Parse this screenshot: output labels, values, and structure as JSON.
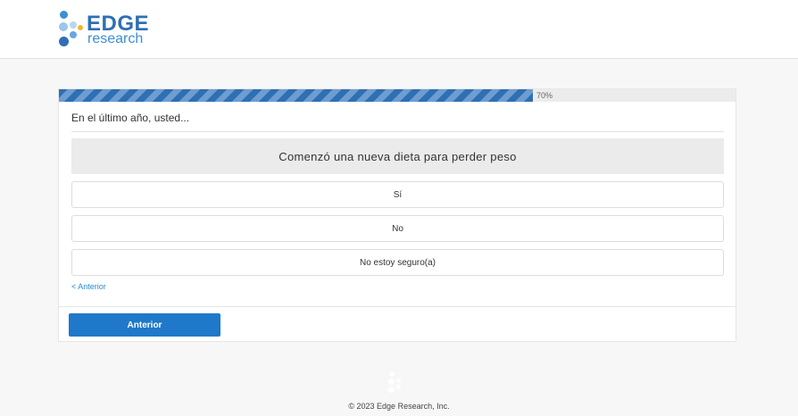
{
  "header": {
    "logo": {
      "word1": "EDGE",
      "word2": "research"
    }
  },
  "progress": {
    "percent_value": 70,
    "label": "70%"
  },
  "question": {
    "prompt": "En el último año, usted...",
    "statement": "Comenzó una nueva dieta para perder peso",
    "options": [
      "Sí",
      "No",
      "No estoy seguro(a)"
    ]
  },
  "nav": {
    "back_link": "< Anterior",
    "prev_button": "Anterior"
  },
  "footer": {
    "copyright": "© 2023 Edge Research, Inc."
  },
  "colors": {
    "brand_blue": "#2f6fb3",
    "accent_light": "#3d8fd0",
    "button": "#1f78c9",
    "link": "#2a8ccf"
  }
}
